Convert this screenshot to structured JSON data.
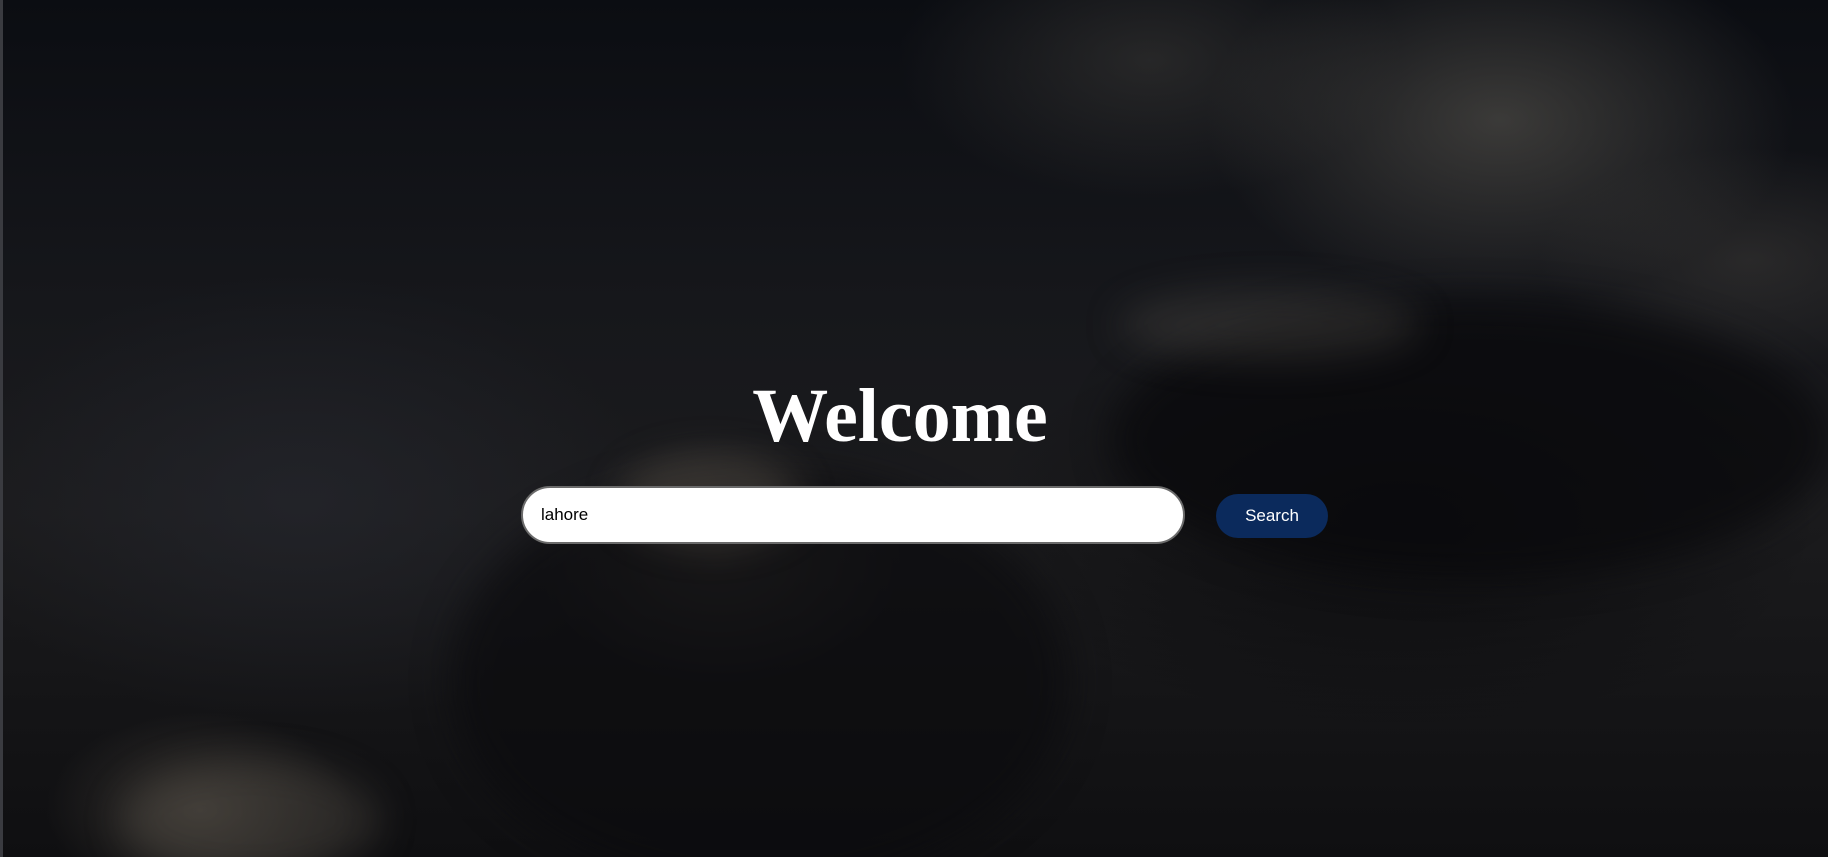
{
  "hero": {
    "title": "Welcome"
  },
  "search": {
    "value": "lahore",
    "button_label": "Search"
  },
  "colors": {
    "button_background": "#0b2a5c",
    "button_text": "#ffffff",
    "title_text": "#ffffff",
    "input_background": "#ffffff"
  }
}
